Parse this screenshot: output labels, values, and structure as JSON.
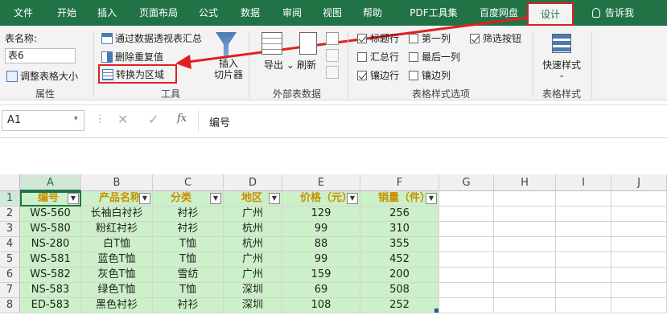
{
  "tabs": [
    "文件",
    "开始",
    "插入",
    "页面布局",
    "公式",
    "数据",
    "审阅",
    "视图",
    "帮助",
    "PDF工具集",
    "百度网盘",
    "设计",
    "告诉我"
  ],
  "ribbon": {
    "props": {
      "table_name_label": "表名称:",
      "table_name_value": "表6",
      "resize_label": "调整表格大小",
      "group": "属性"
    },
    "tools": {
      "pivot": "通过数据透视表汇总",
      "dedupe": "删除重复值",
      "convert": "转换为区域",
      "slicer_line1": "插入",
      "slicer_line2": "切片器",
      "group": "工具"
    },
    "external": {
      "export": "导出",
      "refresh": "刷新",
      "group": "外部表数据"
    },
    "style_options": {
      "items": [
        {
          "label": "标题行",
          "checked": true
        },
        {
          "label": "第一列",
          "checked": false
        },
        {
          "label": "筛选按钮",
          "checked": true
        },
        {
          "label": "汇总行",
          "checked": false
        },
        {
          "label": "最后一列",
          "checked": false
        },
        {
          "label": "镶边行",
          "checked": true
        },
        {
          "label": "镶边列",
          "checked": false
        }
      ],
      "group": "表格样式选项"
    },
    "styles": {
      "quick": "快速样式",
      "group": "表格样式"
    }
  },
  "formula_bar": {
    "name_box": "A1",
    "fx": "fx",
    "content": "编号"
  },
  "columns": [
    "A",
    "B",
    "C",
    "D",
    "E",
    "F",
    "G",
    "H",
    "I",
    "J"
  ],
  "rows": [
    "1",
    "2",
    "3",
    "4",
    "5",
    "6",
    "7",
    "8"
  ],
  "table": {
    "headers": [
      "编号",
      "产品名称",
      "分类",
      "地区",
      "价格（元）",
      "销量（件）"
    ],
    "data": [
      [
        "WS-560",
        "长袖白衬衫",
        "衬衫",
        "广州",
        "129",
        "256"
      ],
      [
        "WS-580",
        "粉红衬衫",
        "衬衫",
        "杭州",
        "99",
        "310"
      ],
      [
        "NS-280",
        "白T恤",
        "T恤",
        "杭州",
        "88",
        "355"
      ],
      [
        "WS-581",
        "蓝色T恤",
        "T恤",
        "广州",
        "99",
        "452"
      ],
      [
        "WS-582",
        "灰色T恤",
        "雪纺",
        "广州",
        "159",
        "200"
      ],
      [
        "NS-583",
        "绿色T恤",
        "T恤",
        "深圳",
        "69",
        "508"
      ],
      [
        "ED-583",
        "黑色衬衫",
        "衬衫",
        "深圳",
        "108",
        "252"
      ]
    ]
  },
  "colors": {
    "accent": "#217346",
    "band": "#ccf0c8",
    "header_text": "#c98f00",
    "callout": "#e02020"
  }
}
